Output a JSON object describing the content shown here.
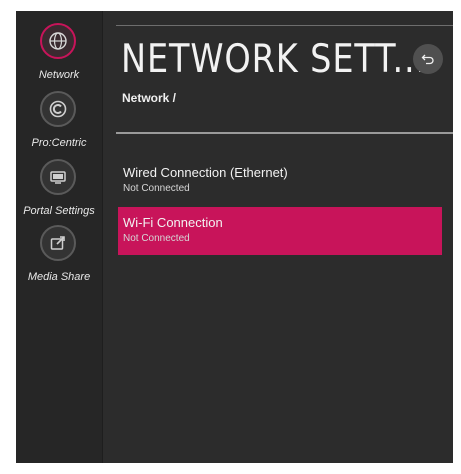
{
  "sidebar": {
    "items": [
      {
        "label": "Network",
        "icon": "globe-icon",
        "active": true
      },
      {
        "label": "Pro:Centric",
        "icon": "procentric-icon",
        "active": false
      },
      {
        "label": "Portal Settings",
        "icon": "tv-portal-icon",
        "active": false
      },
      {
        "label": "Media Share",
        "icon": "media-share-icon",
        "active": false
      }
    ]
  },
  "header": {
    "title": "NETWORK SETT...",
    "breadcrumb": "Network /",
    "back_icon": "back-arrow-icon"
  },
  "menu": {
    "items": [
      {
        "title": "Wired Connection (Ethernet)",
        "status": "Not Connected",
        "selected": false
      },
      {
        "title": "Wi-Fi Connection",
        "status": "Not Connected",
        "selected": true
      }
    ]
  },
  "colors": {
    "accent": "#c8145a",
    "background": "#2c2c2c",
    "sidebar": "#262626"
  }
}
